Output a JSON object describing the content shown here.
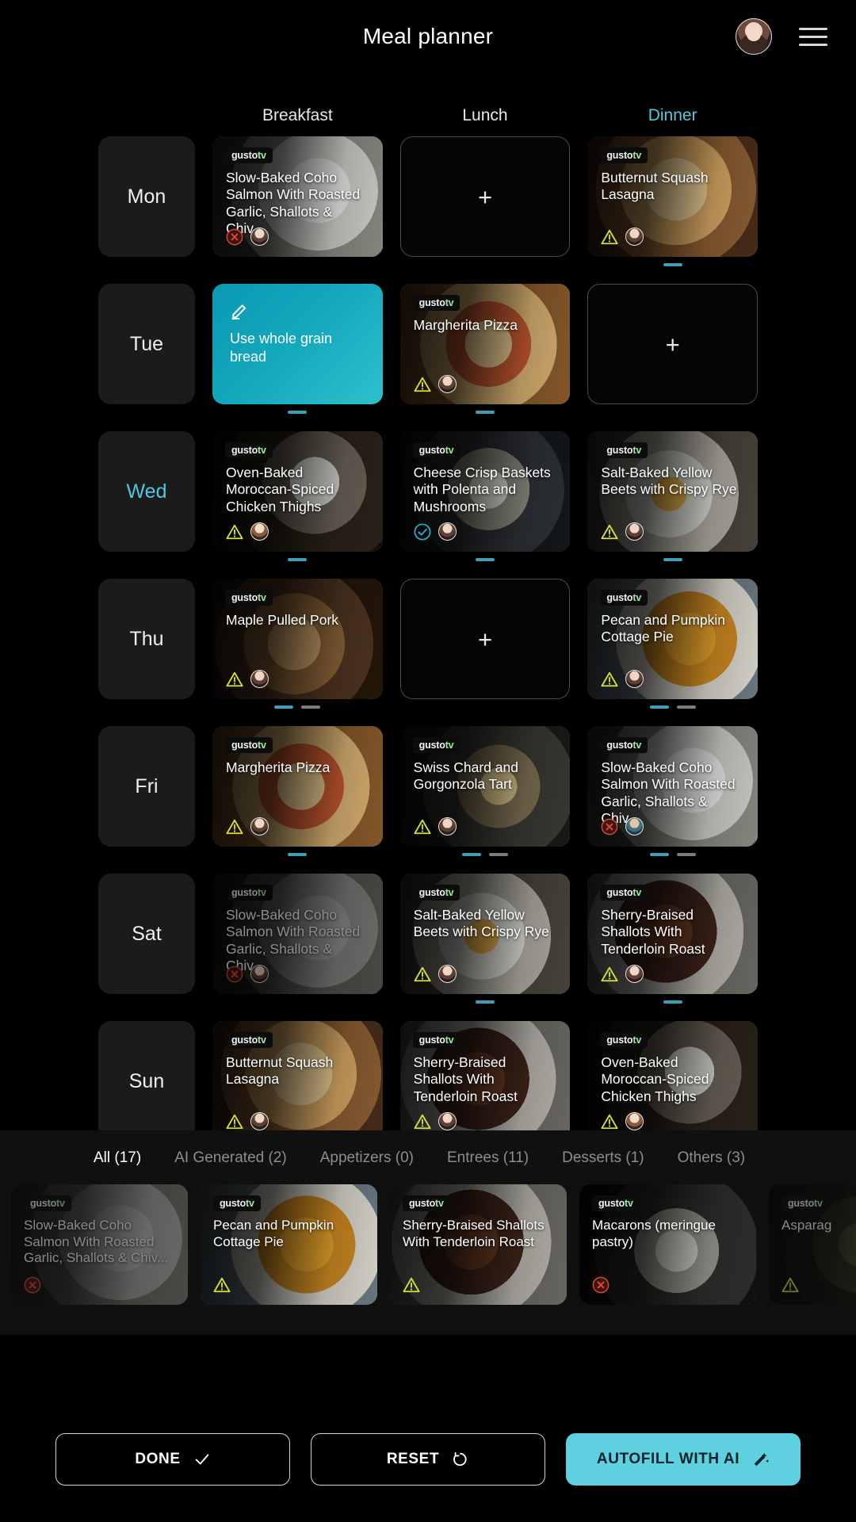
{
  "header": {
    "title": "Meal planner",
    "avatar_name": "user-avatar",
    "menu_name": "hamburger-menu"
  },
  "meal_columns": [
    {
      "label": "Breakfast",
      "active": false
    },
    {
      "label": "Lunch",
      "active": false
    },
    {
      "label": "Dinner",
      "active": true
    }
  ],
  "brand": {
    "name": "gusto",
    "suffix": "tv"
  },
  "days": [
    {
      "day": "Mon",
      "today": false,
      "slots": [
        {
          "type": "meal",
          "title": "Slow-Baked Coho Salmon With Roasted Garlic, Shallots & Chiv...",
          "status": "error",
          "avatar": "a",
          "dots": 0,
          "dim": false,
          "photo": "salmon"
        },
        {
          "type": "empty",
          "add_label": "+"
        },
        {
          "type": "meal",
          "title": "Butternut Squash Lasagna",
          "status": "warning",
          "avatar": "a",
          "dots": 1,
          "dim": false,
          "photo": "lasagna"
        }
      ]
    },
    {
      "day": "Tue",
      "today": false,
      "slots": [
        {
          "type": "note",
          "title": "Use whole grain bread",
          "dots": 1
        },
        {
          "type": "meal",
          "title": "Margherita Pizza",
          "status": "warning",
          "avatar": "a",
          "dots": 1,
          "dim": false,
          "photo": "pizza"
        },
        {
          "type": "empty",
          "add_label": "+"
        }
      ]
    },
    {
      "day": "Wed",
      "today": true,
      "slots": [
        {
          "type": "meal",
          "title": "Oven-Baked Moroccan-Spiced Chicken Thighs",
          "status": "warning",
          "avatar": "c",
          "dots": 1,
          "dim": false,
          "photo": "chicken"
        },
        {
          "type": "meal",
          "title": "Cheese Crisp Baskets with Polenta and Mushrooms",
          "status": "ok",
          "avatar": "a",
          "dots": 1,
          "dim": false,
          "photo": "cheese"
        },
        {
          "type": "meal",
          "title": "Salt-Baked Yellow Beets with Crispy Rye",
          "status": "warning",
          "avatar": "a",
          "dots": 1,
          "dim": false,
          "photo": "beets"
        }
      ]
    },
    {
      "day": "Thu",
      "today": false,
      "slots": [
        {
          "type": "meal",
          "title": "Maple Pulled Pork",
          "status": "warning",
          "avatar": "a",
          "dots": 2,
          "dim": false,
          "photo": "pork"
        },
        {
          "type": "empty",
          "add_label": "+"
        },
        {
          "type": "meal",
          "title": "Pecan and Pumpkin Cottage Pie",
          "status": "warning",
          "avatar": "a",
          "dots": 2,
          "dim": false,
          "photo": "pie"
        }
      ]
    },
    {
      "day": "Fri",
      "today": false,
      "slots": [
        {
          "type": "meal",
          "title": "Margherita Pizza",
          "status": "warning",
          "avatar": "a",
          "dots": 1,
          "dim": false,
          "photo": "pizza"
        },
        {
          "type": "meal",
          "title": "Swiss Chard and Gorgonzola Tart",
          "status": "warning",
          "avatar": "a",
          "dots": 2,
          "dim": false,
          "photo": "tart"
        },
        {
          "type": "meal",
          "title": "Slow-Baked Coho Salmon With Roasted Garlic, Shallots & Chiv...",
          "status": "error",
          "avatar": "b",
          "dots": 2,
          "dim": false,
          "photo": "salmon"
        }
      ]
    },
    {
      "day": "Sat",
      "today": false,
      "slots": [
        {
          "type": "meal",
          "title": "Slow-Baked Coho Salmon With Roasted Garlic, Shallots & Chiv...",
          "status": "error",
          "avatar": "a",
          "dots": 0,
          "dim": true,
          "photo": "salmon"
        },
        {
          "type": "meal",
          "title": "Salt-Baked Yellow Beets with Crispy Rye",
          "status": "warning",
          "avatar": "a",
          "dots": 1,
          "dim": false,
          "photo": "beets"
        },
        {
          "type": "meal",
          "title": "Sherry-Braised Shallots With Tenderloin Roast",
          "status": "warning",
          "avatar": "a",
          "dots": 1,
          "dim": false,
          "photo": "shallots"
        }
      ]
    },
    {
      "day": "Sun",
      "today": false,
      "slots": [
        {
          "type": "meal",
          "title": "Butternut Squash Lasagna",
          "status": "warning",
          "avatar": "a",
          "dots": 1,
          "dim": false,
          "photo": "lasagna"
        },
        {
          "type": "meal",
          "title": "Sherry-Braised Shallots With Tenderloin Roast",
          "status": "warning",
          "avatar": "a",
          "dots": 1,
          "dim": false,
          "photo": "shallots"
        },
        {
          "type": "meal",
          "title": "Oven-Baked Moroccan-Spiced Chicken Thighs",
          "status": "warning",
          "avatar": "c",
          "dots": 1,
          "dim": false,
          "photo": "chicken"
        }
      ]
    }
  ],
  "drawer": {
    "filters": [
      {
        "label": "All (17)",
        "active": true
      },
      {
        "label": "AI Generated (2)",
        "active": false
      },
      {
        "label": "Appetizers (0)",
        "active": false
      },
      {
        "label": "Entrees (11)",
        "active": false
      },
      {
        "label": "Desserts (1)",
        "active": false
      },
      {
        "label": "Others (3)",
        "active": false
      }
    ],
    "recipes": [
      {
        "title": "Slow-Baked Coho Salmon With Roasted Garlic, Shallots & Chiv...",
        "status": "error",
        "dim": true,
        "photo": "salmon"
      },
      {
        "title": "Pecan and Pumpkin Cottage Pie",
        "status": "warning",
        "dim": false,
        "photo": "pie"
      },
      {
        "title": "Sherry-Braised Shallots With Tenderloin Roast",
        "status": "warning",
        "dim": false,
        "photo": "shallots"
      },
      {
        "title": "Macarons (meringue pastry)",
        "status": "error",
        "dim": false,
        "photo": "macarons"
      },
      {
        "title": "Asparag",
        "status": "warning",
        "dim": true,
        "photo": "asparagus"
      }
    ]
  },
  "actions": [
    {
      "label": "DONE",
      "icon": "check-icon",
      "style": "outline"
    },
    {
      "label": "RESET",
      "icon": "undo-icon",
      "style": "outline"
    },
    {
      "label": "AUTOFILL WITH AI",
      "icon": "magic-wand-icon",
      "style": "primary"
    }
  ],
  "colors": {
    "accent": "#5ed0e0",
    "today": "#4ec8e0",
    "warning": "#d6e03a",
    "error": "#d9482f",
    "ok": "#2aa6c4",
    "background": "#000000",
    "drawer_bg": "#101010",
    "day_chip_bg": "#1b1b1b"
  }
}
